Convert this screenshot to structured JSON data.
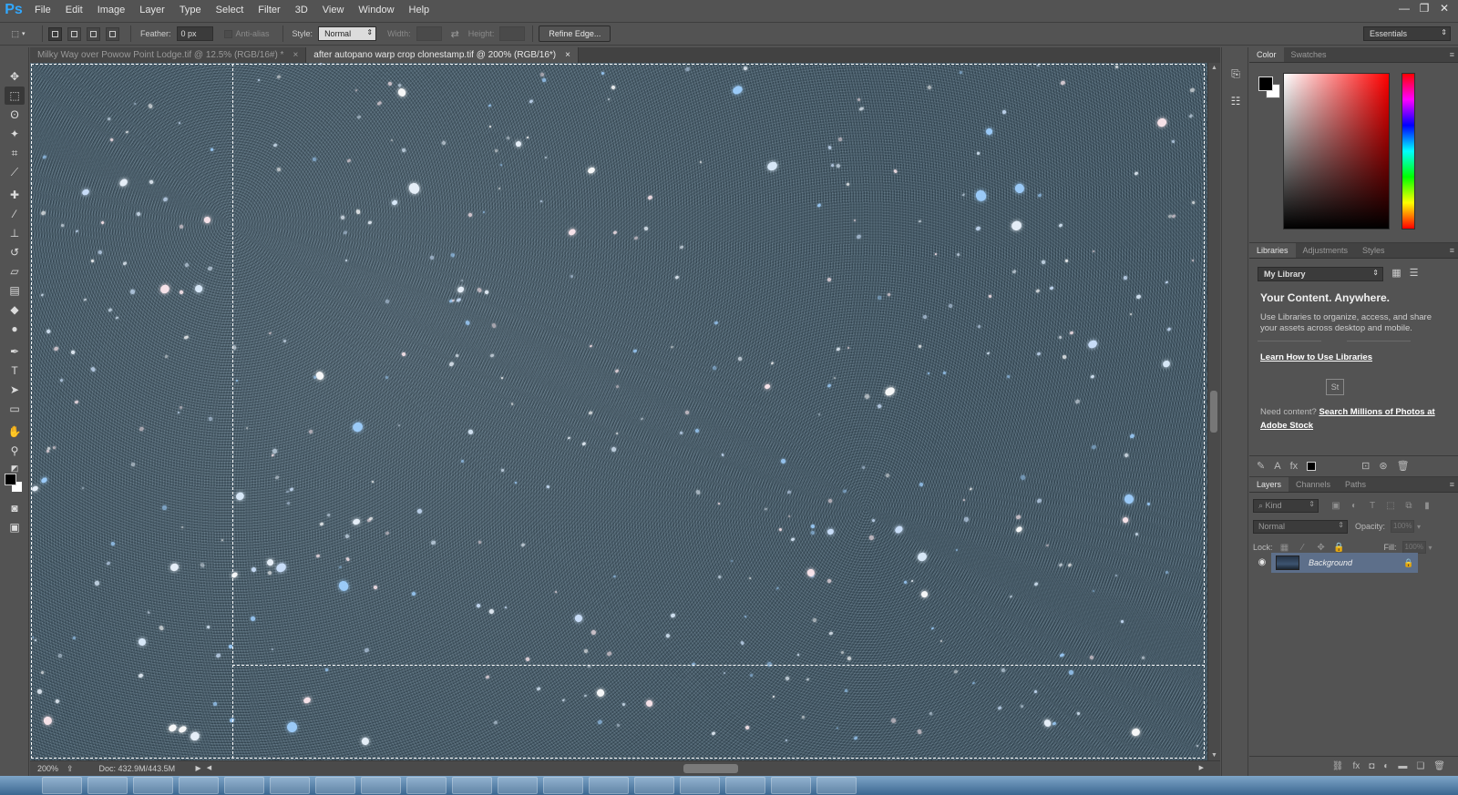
{
  "app": {
    "logo": "Ps"
  },
  "menu": [
    "File",
    "Edit",
    "Image",
    "Layer",
    "Type",
    "Select",
    "Filter",
    "3D",
    "View",
    "Window",
    "Help"
  ],
  "window_controls": {
    "minimize": "—",
    "restore": "❐",
    "close": "✕"
  },
  "options": {
    "feather_label": "Feather:",
    "feather_value": "0 px",
    "antialias_label": "Anti-alias",
    "style_label": "Style:",
    "style_value": "Normal",
    "width_label": "Width:",
    "height_label": "Height:",
    "refine_label": "Refine Edge...",
    "workspace": "Essentials"
  },
  "tabs": [
    {
      "title": "Milky Way over Powow Point Lodge.tif @ 12.5% (RGB/16#) *",
      "close": "×"
    },
    {
      "title": "after autopano warp crop clonestamp.tif @ 200% (RGB/16*)",
      "close": "×"
    }
  ],
  "status": {
    "zoom": "200%",
    "doc": "Doc: 432.9M/443.5M"
  },
  "color_panel": {
    "tabs": [
      "Color",
      "Swatches"
    ],
    "fg": "#000000",
    "bg": "#ffffff"
  },
  "libraries": {
    "tabs": [
      "Libraries",
      "Adjustments",
      "Styles"
    ],
    "library_name": "My Library",
    "heading": "Your Content. Anywhere.",
    "body": "Use Libraries to organize, access, and share your assets across desktop and mobile.",
    "link": "Learn How to Use Libraries",
    "badge": "St",
    "need_content": "Need content?",
    "stock_link": "Search Millions of Photos at Adobe Stock"
  },
  "layers": {
    "tabs": [
      "Layers",
      "Channels",
      "Paths"
    ],
    "kind": "Kind",
    "blend_mode": "Normal",
    "opacity_label": "Opacity:",
    "opacity_value": "100%",
    "lock_label": "Lock:",
    "fill_label": "Fill:",
    "fill_value": "100%",
    "items": [
      {
        "name": "Background",
        "visible": true,
        "locked": true
      }
    ]
  },
  "colors": {
    "accent": "#31a8ff",
    "panel_bg": "#535353",
    "selected_layer": "#5d6f8a"
  }
}
